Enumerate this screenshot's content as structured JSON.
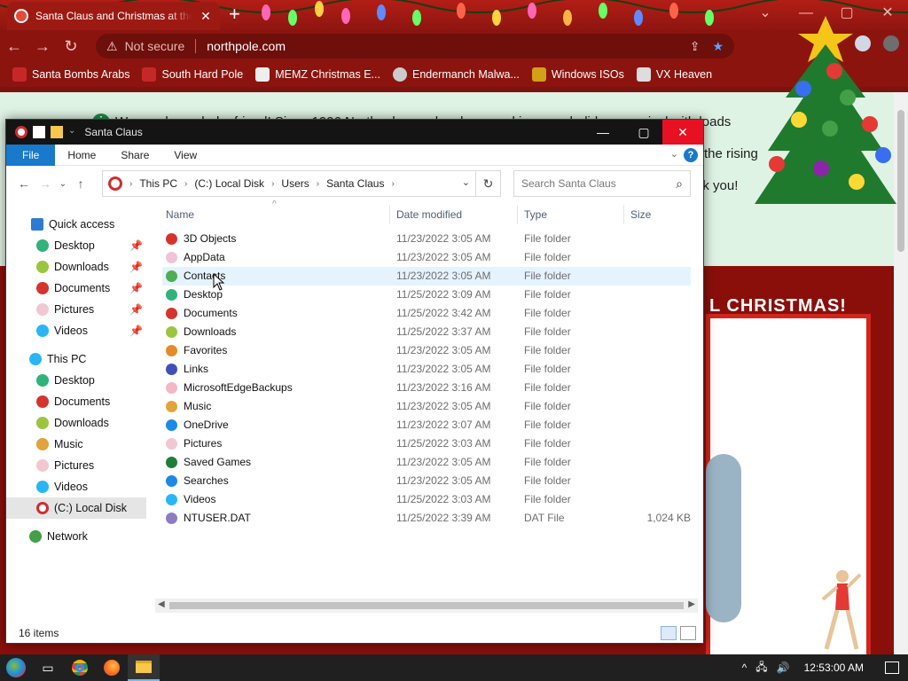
{
  "browser": {
    "tab_title": "Santa Claus and Christmas at the",
    "tab_close": "✕",
    "new_tab": "+",
    "address": {
      "security_label": "Not secure",
      "url": "northpole.com"
    },
    "bookmarks": [
      {
        "label": "Santa Bombs Arabs",
        "icon": "bookmark-icon"
      },
      {
        "label": "South Hard Pole",
        "icon": "bookmark-icon"
      },
      {
        "label": "MEMZ Christmas E...",
        "icon": "page-icon"
      },
      {
        "label": "Endermanch Malwa...",
        "icon": "enderman-icon"
      },
      {
        "label": "Windows ISOs",
        "icon": "bookmark-icon"
      },
      {
        "label": "VX Heaven",
        "icon": "bookmark-icon"
      }
    ]
  },
  "page": {
    "alert_lines": [
      "We need your help, friend! Since 1996 Northpole.com has been making your holidays magical with loads",
      "the rising",
      "nk you!"
    ],
    "banner_fragment": "L CHRISTMAS!"
  },
  "explorer": {
    "window_title": "Santa Claus",
    "ribbon_tabs": [
      "File",
      "Home",
      "Share",
      "View"
    ],
    "help_label": "?",
    "breadcrumb": [
      "This PC",
      "(C:) Local Disk",
      "Users",
      "Santa Claus"
    ],
    "search_placeholder": "Search Santa Claus",
    "nav": {
      "quick_access": "Quick access",
      "quick_items": [
        "Desktop",
        "Downloads",
        "Documents",
        "Pictures",
        "Videos"
      ],
      "this_pc": "This PC",
      "pc_items": [
        "Desktop",
        "Documents",
        "Downloads",
        "Music",
        "Pictures",
        "Videos",
        "(C:) Local Disk"
      ],
      "network": "Network"
    },
    "columns": {
      "name": "Name",
      "date": "Date modified",
      "type": "Type",
      "size": "Size"
    },
    "files": [
      {
        "name": "3D Objects",
        "date": "11/23/2022 3:05 AM",
        "type": "File folder",
        "size": "",
        "color": "#d6332d"
      },
      {
        "name": "AppData",
        "date": "11/23/2022 3:05 AM",
        "type": "File folder",
        "size": "",
        "color": "#f0c4d6"
      },
      {
        "name": "Contacts",
        "date": "11/23/2022 3:05 AM",
        "type": "File folder",
        "size": "",
        "color": "#4caf50"
      },
      {
        "name": "Desktop",
        "date": "11/25/2022 3:09 AM",
        "type": "File folder",
        "size": "",
        "color": "#2fb37a"
      },
      {
        "name": "Documents",
        "date": "11/25/2022 3:42 AM",
        "type": "File folder",
        "size": "",
        "color": "#d6332d"
      },
      {
        "name": "Downloads",
        "date": "11/25/2022 3:37 AM",
        "type": "File folder",
        "size": "",
        "color": "#9bc53d"
      },
      {
        "name": "Favorites",
        "date": "11/23/2022 3:05 AM",
        "type": "File folder",
        "size": "",
        "color": "#e58a2b"
      },
      {
        "name": "Links",
        "date": "11/23/2022 3:05 AM",
        "type": "File folder",
        "size": "",
        "color": "#3f51b5"
      },
      {
        "name": "MicrosoftEdgeBackups",
        "date": "11/23/2022 3:16 AM",
        "type": "File folder",
        "size": "",
        "color": "#f3b7c6"
      },
      {
        "name": "Music",
        "date": "11/23/2022 3:05 AM",
        "type": "File folder",
        "size": "",
        "color": "#e2a33b"
      },
      {
        "name": "OneDrive",
        "date": "11/23/2022 3:07 AM",
        "type": "File folder",
        "size": "",
        "color": "#1e88e5"
      },
      {
        "name": "Pictures",
        "date": "11/25/2022 3:03 AM",
        "type": "File folder",
        "size": "",
        "color": "#f1c8d2"
      },
      {
        "name": "Saved Games",
        "date": "11/23/2022 3:05 AM",
        "type": "File folder",
        "size": "",
        "color": "#1f7d3a"
      },
      {
        "name": "Searches",
        "date": "11/23/2022 3:05 AM",
        "type": "File folder",
        "size": "",
        "color": "#1e88e5"
      },
      {
        "name": "Videos",
        "date": "11/25/2022 3:03 AM",
        "type": "File folder",
        "size": "",
        "color": "#29b6f6"
      },
      {
        "name": "NTUSER.DAT",
        "date": "11/25/2022 3:39 AM",
        "type": "DAT File",
        "size": "1,024 KB",
        "color": "#8e7cc3"
      }
    ],
    "status_count": "16 items"
  },
  "taskbar": {
    "clock": "12:53:00 AM"
  }
}
